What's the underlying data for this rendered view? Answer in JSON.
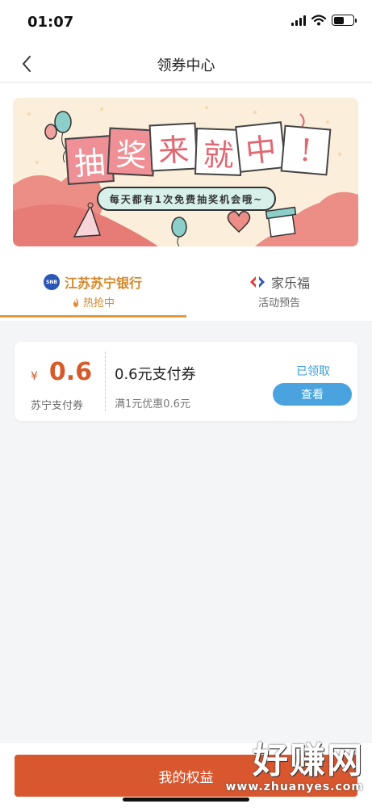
{
  "status_bar": {
    "time": "01:07"
  },
  "nav": {
    "title": "领券中心"
  },
  "banner": {
    "title_chars": [
      "抽",
      "奖",
      "来",
      "就",
      "中",
      "!"
    ],
    "subtitle": "每天都有1次免费抽奖机会哦~"
  },
  "tabs": [
    {
      "name": "江苏苏宁银行",
      "status": "热抢中",
      "logo_text": "SNB",
      "active": true
    },
    {
      "name": "家乐福",
      "status": "活动预告",
      "active": false
    }
  ],
  "coupon": {
    "currency": "¥",
    "amount": "0.6",
    "brand": "苏宁支付券",
    "title": "0.6元支付券",
    "condition": "满1元优惠0.6元",
    "state": "已领取",
    "button": "查看"
  },
  "bottom": {
    "button": "我的权益"
  },
  "watermark": {
    "main": "好赚网",
    "url": "www.zhuanyes.com"
  },
  "colors": {
    "accent_orange": "#e29a39",
    "coupon_red": "#d65a2a",
    "button_blue": "#4aa3df",
    "bottom_button": "#d9572f",
    "banner_bg": "#fbeedb",
    "banner_pink": "#ef8f96"
  },
  "icons": {
    "back": "chevron-left-icon",
    "hot": "flame-icon",
    "carrefour": "carrefour-logo-icon",
    "signal": "signal-icon",
    "wifi": "wifi-icon",
    "battery": "battery-icon"
  }
}
